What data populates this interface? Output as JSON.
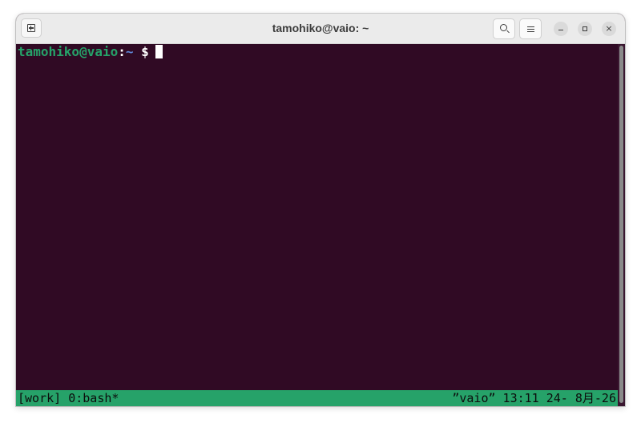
{
  "window": {
    "title": "tamohiko@vaio: ~"
  },
  "icons": {
    "new_tab": "new-tab-icon",
    "search": "search-icon",
    "menu": "hamburger-menu-icon",
    "minimize": "minimize-icon",
    "maximize": "maximize-icon",
    "close": "close-icon",
    "close_glyph": "×"
  },
  "terminal": {
    "prompt_user_host": "tamohiko@vaio",
    "prompt_separator": ":",
    "prompt_path": "~",
    "prompt_symbol": " $"
  },
  "tmux": {
    "left": "[work] 0:bash*",
    "right": "”vaio” 13:11 24- 8月-26"
  },
  "colors": {
    "terminal_background": "#300a24",
    "prompt_user": "#26a269",
    "prompt_path": "#5f87d7",
    "status_bar": "#26a269",
    "titlebar": "#ebebeb"
  }
}
